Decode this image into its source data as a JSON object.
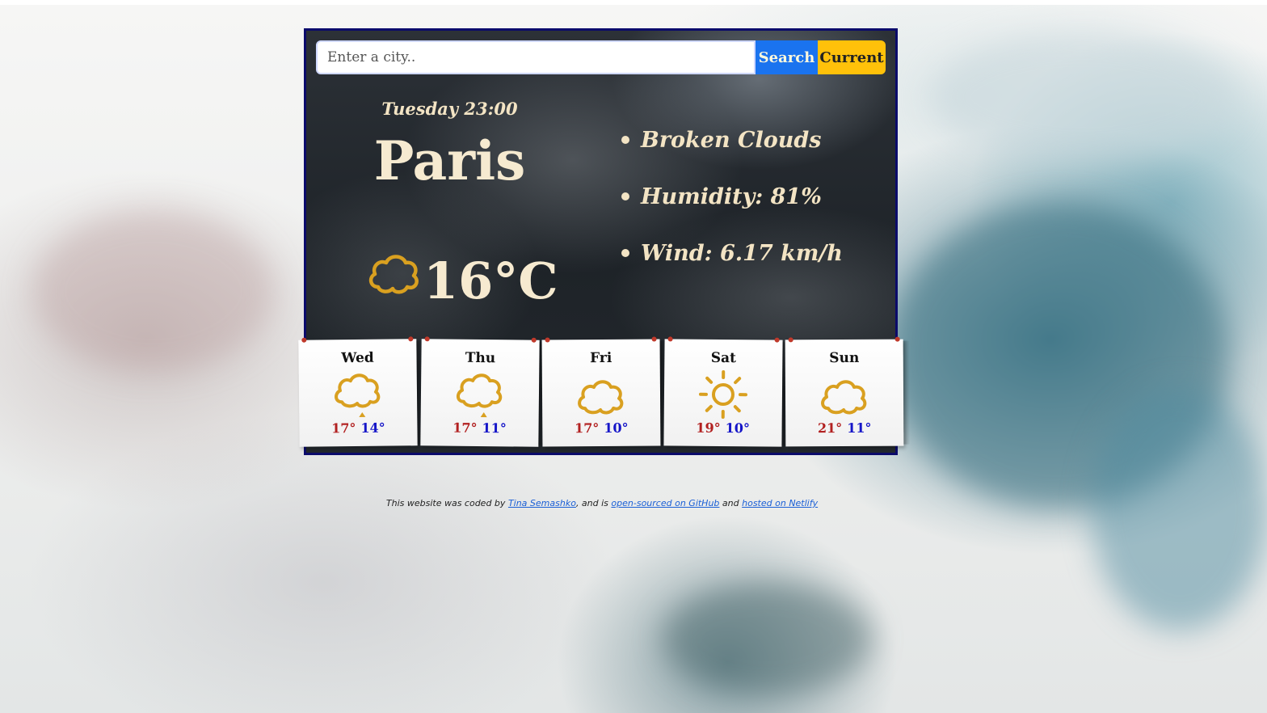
{
  "search": {
    "placeholder": "Enter a city..",
    "search_label": "Search",
    "current_label": "Current"
  },
  "current": {
    "day_time": "Tuesday 23:00",
    "city": "Paris",
    "temperature": "16°C",
    "icon": "cloud-icon",
    "details": {
      "description": "Broken Clouds",
      "humidity": "Humidity: 81%",
      "wind": "Wind: 6.17 km/h"
    }
  },
  "forecast": [
    {
      "day": "Wed",
      "icon": "cloud-rain-icon",
      "max": "17°",
      "min": "14°"
    },
    {
      "day": "Thu",
      "icon": "cloud-rain-icon",
      "max": "17°",
      "min": "11°"
    },
    {
      "day": "Fri",
      "icon": "cloud-icon",
      "max": "17°",
      "min": "10°"
    },
    {
      "day": "Sat",
      "icon": "sun-icon",
      "max": "19°",
      "min": "10°"
    },
    {
      "day": "Sun",
      "icon": "cloud-icon",
      "max": "21°",
      "min": "11°"
    }
  ],
  "footer": {
    "part1": "This website was coded by",
    "author_link": "Tina Semashko",
    "part2": ", and is",
    "github_link": "open-sourced on GitHub",
    "part3": "and",
    "netlify_link": "hosted on Netlify"
  },
  "colors": {
    "accent_blue": "#1a73ef",
    "accent_yellow": "#ffc10a",
    "icon_gold": "#d9a020",
    "card_border": "#0b0b6b",
    "max_temp": "#b22020",
    "min_temp": "#1515c8"
  }
}
